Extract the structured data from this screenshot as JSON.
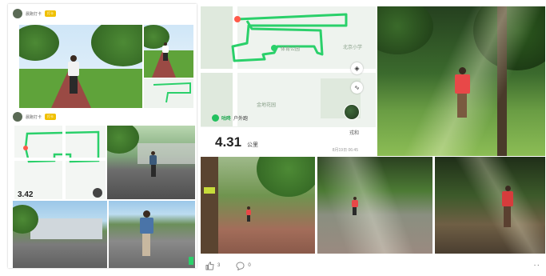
{
  "left_collage": {
    "post1": {
      "user_name": "晨跑打卡",
      "badge": "打卡"
    },
    "post2": {
      "user_name": "晨跑打卡",
      "badge": "打卡"
    },
    "partial_distance": "3.42"
  },
  "run_card": {
    "distance_value": "4.31",
    "distance_unit": "公里",
    "date": "8月19日 06:45",
    "user_name": "戎和",
    "app_brand": "咕咚",
    "activity_type": "户外跑",
    "map_labels": [
      "体育公园",
      "北京小学",
      "金地花园"
    ]
  },
  "interactions": {
    "like_count": "3",
    "comment_count": "0"
  },
  "colors": {
    "route_green": "#2ad06a",
    "brand_green": "#22a852"
  }
}
